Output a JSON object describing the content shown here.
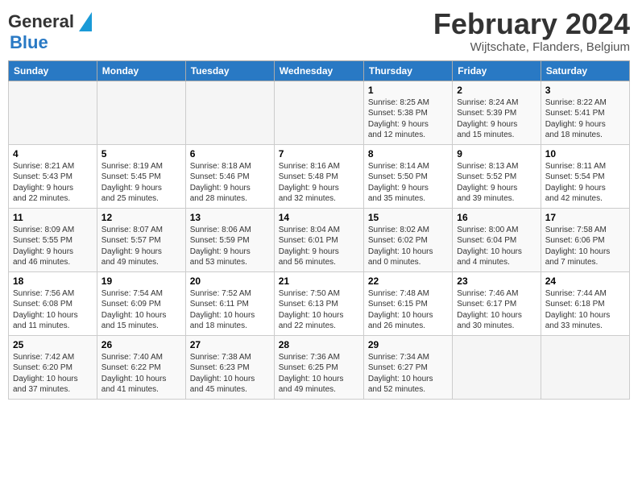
{
  "header": {
    "logo_general": "General",
    "logo_blue": "Blue",
    "month_title": "February 2024",
    "location": "Wijtschate, Flanders, Belgium"
  },
  "days_of_week": [
    "Sunday",
    "Monday",
    "Tuesday",
    "Wednesday",
    "Thursday",
    "Friday",
    "Saturday"
  ],
  "weeks": [
    [
      {
        "day": "",
        "info": ""
      },
      {
        "day": "",
        "info": ""
      },
      {
        "day": "",
        "info": ""
      },
      {
        "day": "",
        "info": ""
      },
      {
        "day": "1",
        "info": "Sunrise: 8:25 AM\nSunset: 5:38 PM\nDaylight: 9 hours\nand 12 minutes."
      },
      {
        "day": "2",
        "info": "Sunrise: 8:24 AM\nSunset: 5:39 PM\nDaylight: 9 hours\nand 15 minutes."
      },
      {
        "day": "3",
        "info": "Sunrise: 8:22 AM\nSunset: 5:41 PM\nDaylight: 9 hours\nand 18 minutes."
      }
    ],
    [
      {
        "day": "4",
        "info": "Sunrise: 8:21 AM\nSunset: 5:43 PM\nDaylight: 9 hours\nand 22 minutes."
      },
      {
        "day": "5",
        "info": "Sunrise: 8:19 AM\nSunset: 5:45 PM\nDaylight: 9 hours\nand 25 minutes."
      },
      {
        "day": "6",
        "info": "Sunrise: 8:18 AM\nSunset: 5:46 PM\nDaylight: 9 hours\nand 28 minutes."
      },
      {
        "day": "7",
        "info": "Sunrise: 8:16 AM\nSunset: 5:48 PM\nDaylight: 9 hours\nand 32 minutes."
      },
      {
        "day": "8",
        "info": "Sunrise: 8:14 AM\nSunset: 5:50 PM\nDaylight: 9 hours\nand 35 minutes."
      },
      {
        "day": "9",
        "info": "Sunrise: 8:13 AM\nSunset: 5:52 PM\nDaylight: 9 hours\nand 39 minutes."
      },
      {
        "day": "10",
        "info": "Sunrise: 8:11 AM\nSunset: 5:54 PM\nDaylight: 9 hours\nand 42 minutes."
      }
    ],
    [
      {
        "day": "11",
        "info": "Sunrise: 8:09 AM\nSunset: 5:55 PM\nDaylight: 9 hours\nand 46 minutes."
      },
      {
        "day": "12",
        "info": "Sunrise: 8:07 AM\nSunset: 5:57 PM\nDaylight: 9 hours\nand 49 minutes."
      },
      {
        "day": "13",
        "info": "Sunrise: 8:06 AM\nSunset: 5:59 PM\nDaylight: 9 hours\nand 53 minutes."
      },
      {
        "day": "14",
        "info": "Sunrise: 8:04 AM\nSunset: 6:01 PM\nDaylight: 9 hours\nand 56 minutes."
      },
      {
        "day": "15",
        "info": "Sunrise: 8:02 AM\nSunset: 6:02 PM\nDaylight: 10 hours\nand 0 minutes."
      },
      {
        "day": "16",
        "info": "Sunrise: 8:00 AM\nSunset: 6:04 PM\nDaylight: 10 hours\nand 4 minutes."
      },
      {
        "day": "17",
        "info": "Sunrise: 7:58 AM\nSunset: 6:06 PM\nDaylight: 10 hours\nand 7 minutes."
      }
    ],
    [
      {
        "day": "18",
        "info": "Sunrise: 7:56 AM\nSunset: 6:08 PM\nDaylight: 10 hours\nand 11 minutes."
      },
      {
        "day": "19",
        "info": "Sunrise: 7:54 AM\nSunset: 6:09 PM\nDaylight: 10 hours\nand 15 minutes."
      },
      {
        "day": "20",
        "info": "Sunrise: 7:52 AM\nSunset: 6:11 PM\nDaylight: 10 hours\nand 18 minutes."
      },
      {
        "day": "21",
        "info": "Sunrise: 7:50 AM\nSunset: 6:13 PM\nDaylight: 10 hours\nand 22 minutes."
      },
      {
        "day": "22",
        "info": "Sunrise: 7:48 AM\nSunset: 6:15 PM\nDaylight: 10 hours\nand 26 minutes."
      },
      {
        "day": "23",
        "info": "Sunrise: 7:46 AM\nSunset: 6:17 PM\nDaylight: 10 hours\nand 30 minutes."
      },
      {
        "day": "24",
        "info": "Sunrise: 7:44 AM\nSunset: 6:18 PM\nDaylight: 10 hours\nand 33 minutes."
      }
    ],
    [
      {
        "day": "25",
        "info": "Sunrise: 7:42 AM\nSunset: 6:20 PM\nDaylight: 10 hours\nand 37 minutes."
      },
      {
        "day": "26",
        "info": "Sunrise: 7:40 AM\nSunset: 6:22 PM\nDaylight: 10 hours\nand 41 minutes."
      },
      {
        "day": "27",
        "info": "Sunrise: 7:38 AM\nSunset: 6:23 PM\nDaylight: 10 hours\nand 45 minutes."
      },
      {
        "day": "28",
        "info": "Sunrise: 7:36 AM\nSunset: 6:25 PM\nDaylight: 10 hours\nand 49 minutes."
      },
      {
        "day": "29",
        "info": "Sunrise: 7:34 AM\nSunset: 6:27 PM\nDaylight: 10 hours\nand 52 minutes."
      },
      {
        "day": "",
        "info": ""
      },
      {
        "day": "",
        "info": ""
      }
    ]
  ]
}
